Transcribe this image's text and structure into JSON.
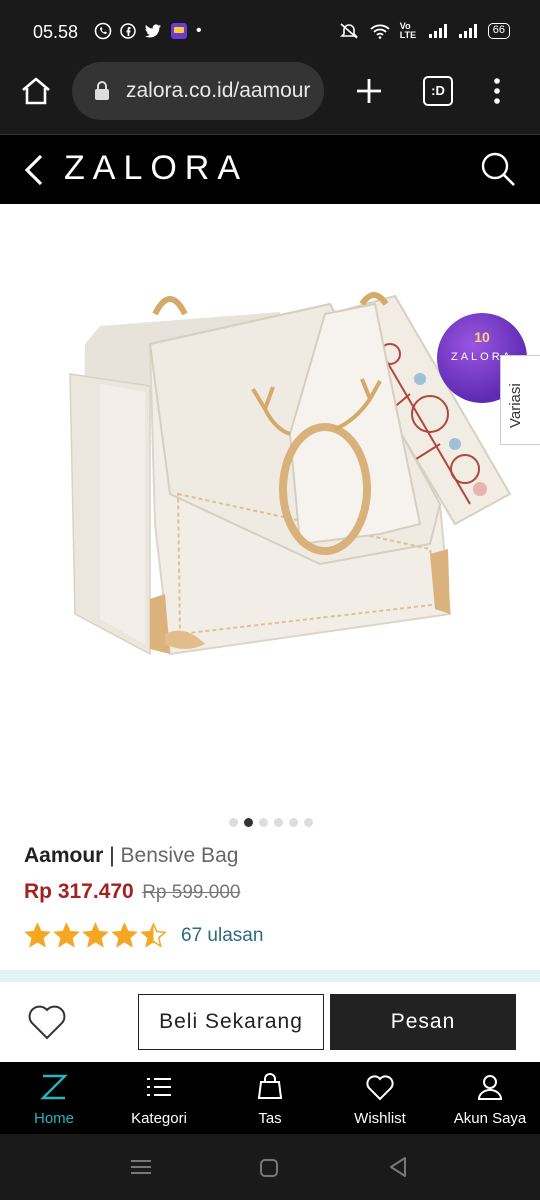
{
  "status_bar": {
    "time": "05.58",
    "network_label": "Vo LTE",
    "battery": "66"
  },
  "browser": {
    "url": "zalora.co.id/aamour",
    "tab_switcher_label": ":D"
  },
  "header": {
    "logo": "ZALORA"
  },
  "badge": {
    "number": "10",
    "text": "ZALORA"
  },
  "variasi_label": "Variasi",
  "carousel": {
    "total": 6,
    "active_index": 1
  },
  "product": {
    "brand": "Aamour",
    "separator": "|",
    "name": "Bensive Bag",
    "price": "Rp 317.470",
    "old_price": "Rp 599.000",
    "rating": 4.5,
    "reviews": "67 ulasan"
  },
  "actions": {
    "buy_now": "Beli Sekarang",
    "order": "Pesan"
  },
  "bottom_nav": {
    "items": [
      {
        "label": "Home",
        "icon": "zalora-z-icon"
      },
      {
        "label": "Kategori",
        "icon": "list-icon"
      },
      {
        "label": "Tas",
        "icon": "bag-icon"
      },
      {
        "label": "Wishlist",
        "icon": "heart-icon"
      },
      {
        "label": "Akun Saya",
        "icon": "user-icon"
      }
    ]
  },
  "colors": {
    "price": "#a1221f",
    "active_nav": "#2bb3c0",
    "stars": "#f5a623",
    "reviews_link": "#2c6c7a"
  }
}
